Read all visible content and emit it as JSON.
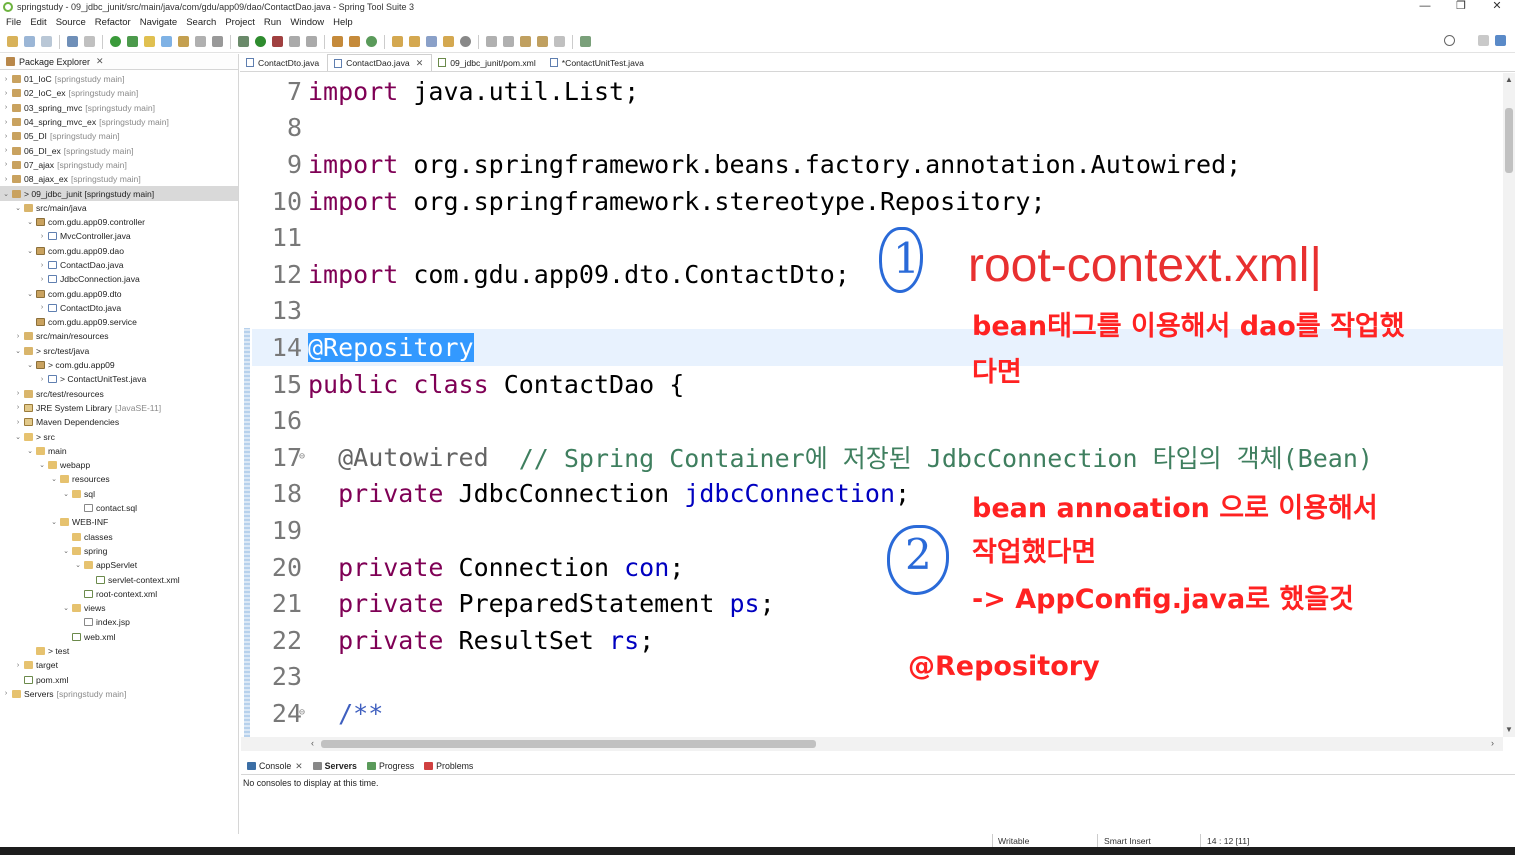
{
  "window": {
    "title": "springstudy - 09_jdbc_junit/src/main/java/com/gdu/app09/dao/ContactDao.java - Spring Tool Suite 3",
    "controls": [
      "—",
      "❐",
      "✕"
    ]
  },
  "menu": [
    "File",
    "Edit",
    "Source",
    "Refactor",
    "Navigate",
    "Search",
    "Project",
    "Run",
    "Window",
    "Help"
  ],
  "package_explorer": {
    "tab_label": "Package Explorer",
    "items": [
      {
        "label": "01_IoC",
        "muted": "[springstudy main]",
        "icon": "proj",
        "depth": 0,
        "arrow": "›"
      },
      {
        "label": "02_IoC_ex",
        "muted": "[springstudy main]",
        "icon": "proj",
        "depth": 0,
        "arrow": "›"
      },
      {
        "label": "03_spring_mvc",
        "muted": "[springstudy main]",
        "icon": "proj",
        "depth": 0,
        "arrow": "›"
      },
      {
        "label": "04_spring_mvc_ex",
        "muted": "[springstudy main]",
        "icon": "proj",
        "depth": 0,
        "arrow": "›"
      },
      {
        "label": "05_DI",
        "muted": "[springstudy main]",
        "icon": "proj",
        "depth": 0,
        "arrow": "›"
      },
      {
        "label": "06_DI_ex",
        "muted": "[springstudy main]",
        "icon": "proj",
        "depth": 0,
        "arrow": "›"
      },
      {
        "label": "07_ajax",
        "muted": "[springstudy main]",
        "icon": "proj",
        "depth": 0,
        "arrow": "›"
      },
      {
        "label": "08_ajax_ex",
        "muted": "[springstudy main]",
        "icon": "proj",
        "depth": 0,
        "arrow": "›"
      },
      {
        "label": "> 09_jdbc_junit [springstudy main]",
        "muted": "",
        "icon": "proj",
        "depth": 0,
        "arrow": "⌄",
        "selected": true
      },
      {
        "label": "src/main/java",
        "muted": "",
        "icon": "pkgfolder",
        "depth": 1,
        "arrow": "⌄"
      },
      {
        "label": "com.gdu.app09.controller",
        "muted": "",
        "icon": "pkg",
        "depth": 2,
        "arrow": "⌄"
      },
      {
        "label": "MvcController.java",
        "muted": "",
        "icon": "java",
        "depth": 3,
        "arrow": "›"
      },
      {
        "label": "com.gdu.app09.dao",
        "muted": "",
        "icon": "pkg",
        "depth": 2,
        "arrow": "⌄"
      },
      {
        "label": "ContactDao.java",
        "muted": "",
        "icon": "java",
        "depth": 3,
        "arrow": "›"
      },
      {
        "label": "JdbcConnection.java",
        "muted": "",
        "icon": "java",
        "depth": 3,
        "arrow": "›"
      },
      {
        "label": "com.gdu.app09.dto",
        "muted": "",
        "icon": "pkg",
        "depth": 2,
        "arrow": "⌄"
      },
      {
        "label": "ContactDto.java",
        "muted": "",
        "icon": "java",
        "depth": 3,
        "arrow": "›"
      },
      {
        "label": "com.gdu.app09.service",
        "muted": "",
        "icon": "pkg",
        "depth": 2,
        "arrow": ""
      },
      {
        "label": "src/main/resources",
        "muted": "",
        "icon": "pkgfolder",
        "depth": 1,
        "arrow": "›"
      },
      {
        "label": "> src/test/java",
        "muted": "",
        "icon": "pkgfolder",
        "depth": 1,
        "arrow": "⌄"
      },
      {
        "label": "> com.gdu.app09",
        "muted": "",
        "icon": "pkg",
        "depth": 2,
        "arrow": "⌄"
      },
      {
        "label": "> ContactUnitTest.java",
        "muted": "",
        "icon": "java",
        "depth": 3,
        "arrow": "›"
      },
      {
        "label": "src/test/resources",
        "muted": "",
        "icon": "pkgfolder",
        "depth": 1,
        "arrow": "›"
      },
      {
        "label": "JRE System Library",
        "muted": "[JavaSE-11]",
        "icon": "lib",
        "depth": 1,
        "arrow": "›"
      },
      {
        "label": "Maven Dependencies",
        "muted": "",
        "icon": "lib",
        "depth": 1,
        "arrow": "›"
      },
      {
        "label": "> src",
        "muted": "",
        "icon": "folder",
        "depth": 1,
        "arrow": "⌄"
      },
      {
        "label": "main",
        "muted": "",
        "icon": "folder",
        "depth": 2,
        "arrow": "⌄"
      },
      {
        "label": "webapp",
        "muted": "",
        "icon": "folder",
        "depth": 3,
        "arrow": "⌄"
      },
      {
        "label": "resources",
        "muted": "",
        "icon": "folder",
        "depth": 4,
        "arrow": "⌄"
      },
      {
        "label": "sql",
        "muted": "",
        "icon": "folder",
        "depth": 5,
        "arrow": "⌄"
      },
      {
        "label": "contact.sql",
        "muted": "",
        "icon": "file",
        "depth": 6,
        "arrow": ""
      },
      {
        "label": "WEB-INF",
        "muted": "",
        "icon": "folder",
        "depth": 4,
        "arrow": "⌄"
      },
      {
        "label": "classes",
        "muted": "",
        "icon": "folder",
        "depth": 5,
        "arrow": ""
      },
      {
        "label": "spring",
        "muted": "",
        "icon": "folder",
        "depth": 5,
        "arrow": "⌄"
      },
      {
        "label": "appServlet",
        "muted": "",
        "icon": "folder",
        "depth": 6,
        "arrow": "⌄"
      },
      {
        "label": "servlet-context.xml",
        "muted": "",
        "icon": "xml",
        "depth": 7,
        "arrow": ""
      },
      {
        "label": "root-context.xml",
        "muted": "",
        "icon": "xml",
        "depth": 6,
        "arrow": ""
      },
      {
        "label": "views",
        "muted": "",
        "icon": "folder",
        "depth": 5,
        "arrow": "⌄"
      },
      {
        "label": "index.jsp",
        "muted": "",
        "icon": "file",
        "depth": 6,
        "arrow": ""
      },
      {
        "label": "web.xml",
        "muted": "",
        "icon": "xml",
        "depth": 5,
        "arrow": ""
      },
      {
        "label": "> test",
        "muted": "",
        "icon": "folder",
        "depth": 2,
        "arrow": ""
      },
      {
        "label": "target",
        "muted": "",
        "icon": "folder",
        "depth": 1,
        "arrow": "›"
      },
      {
        "label": "pom.xml",
        "muted": "",
        "icon": "xml",
        "depth": 1,
        "arrow": ""
      },
      {
        "label": "Servers",
        "muted": "[springstudy main]",
        "icon": "folder",
        "depth": 0,
        "arrow": "›"
      }
    ]
  },
  "editor_tabs": [
    {
      "label": "ContactDto.java",
      "icon": "java",
      "active": false
    },
    {
      "label": "ContactDao.java",
      "icon": "java",
      "active": true,
      "close": "✕"
    },
    {
      "label": "09_jdbc_junit/pom.xml",
      "icon": "xml",
      "active": false
    },
    {
      "label": "*ContactUnitTest.java",
      "icon": "java",
      "active": false
    }
  ],
  "code": {
    "l7": {
      "num": "7",
      "a": "import",
      "b": " java.util.List;"
    },
    "l8": {
      "num": "8"
    },
    "l9": {
      "num": "9",
      "a": "import",
      "b": " org.springframework.beans.factory.annotation.Autowired;"
    },
    "l10": {
      "num": "10",
      "a": "import",
      "b": " org.springframework.stereotype.Repository;"
    },
    "l11": {
      "num": "11"
    },
    "l12": {
      "num": "12",
      "a": "import",
      "b": " com.gdu.app09.dto.ContactDto;"
    },
    "l13": {
      "num": "13"
    },
    "l14": {
      "num": "14",
      "a": "@Repository"
    },
    "l15": {
      "num": "15",
      "a": "public",
      "b": " ",
      "c": "class",
      "d": " ContactDao {"
    },
    "l16": {
      "num": "16"
    },
    "l17": {
      "num": "17",
      "a": "  @Autowired",
      "b": "  // Spring Container에 저장된 JdbcConnection 타입의 객체(Bean)"
    },
    "l18": {
      "num": "18",
      "a": "  private",
      "b": " JdbcConnection ",
      "c": "jdbcConnection",
      "d": ";"
    },
    "l19": {
      "num": "19"
    },
    "l20": {
      "num": "20",
      "a": "  private",
      "b": " Connection ",
      "c": "con",
      "d": ";"
    },
    "l21": {
      "num": "21",
      "a": "  private",
      "b": " PreparedStatement ",
      "c": "ps",
      "d": ";"
    },
    "l22": {
      "num": "22",
      "a": "  private",
      "b": " ResultSet ",
      "c": "rs",
      "d": ";"
    },
    "l23": {
      "num": "23"
    },
    "l24": {
      "num": "24",
      "a": "  /**"
    },
    "fold_marker": "⊖"
  },
  "annotations": {
    "circle1": "1",
    "circle2": "2",
    "root_context": "root-context.xml|",
    "bean_tag_line1": "bean태그를 이용해서 dao를 작업했",
    "bean_tag_line2": "다면",
    "bean_anno_line1": "bean annoation 으로 이용해서",
    "bean_anno_line2": "작업했다면",
    "bean_anno_line3": "-> AppConfig.java로 했을것",
    "repository": "@Repository"
  },
  "bottom_panel": {
    "tabs": [
      {
        "label": "Console",
        "close": "✕",
        "active": false
      },
      {
        "label": "Servers",
        "active": true
      },
      {
        "label": "Progress",
        "active": false
      },
      {
        "label": "Problems",
        "active": false
      }
    ],
    "console_message": "No consoles to display at this time."
  },
  "status": {
    "writable": "Writable",
    "insert_mode": "Smart Insert",
    "position": "14 : 12 [11]"
  },
  "colors": {
    "keyword": "#7f0055",
    "annotation": "#646464",
    "comment": "#3f7f5f",
    "field": "#0000c0",
    "overlay_red": "#ff2222",
    "hand_blue": "#2a6ad8"
  }
}
